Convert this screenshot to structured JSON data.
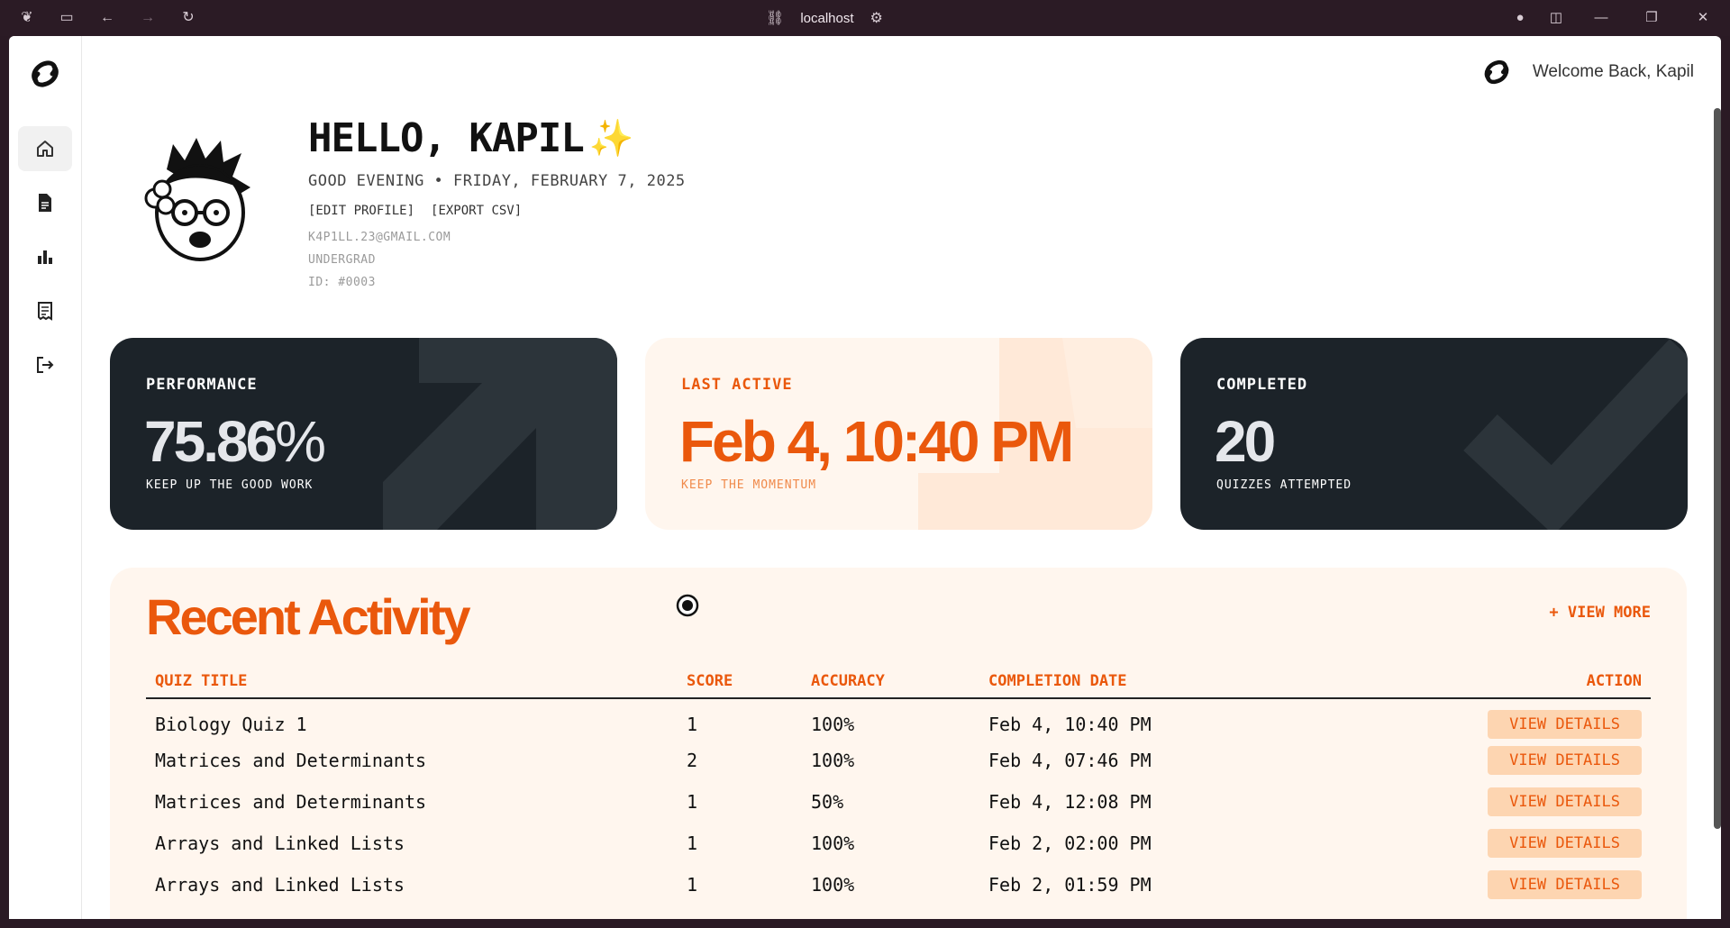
{
  "browser": {
    "url": "localhost"
  },
  "header": {
    "welcome": "Welcome Back, Kapil"
  },
  "profile": {
    "hello": "HELLO, KAPIL",
    "sparkle": "✨",
    "greeting": "GOOD EVENING • FRIDAY, FEBRUARY 7, 2025",
    "edit_profile": "[EDIT PROFILE]",
    "export_csv": "[EXPORT CSV]",
    "email": "K4P1LL.23@GMAIL.COM",
    "level": "UNDERGRAD",
    "id": "ID: #0003"
  },
  "sidebar": {
    "items": [
      {
        "name": "home",
        "active": true
      },
      {
        "name": "quizzes",
        "active": false
      },
      {
        "name": "analytics",
        "active": false
      },
      {
        "name": "reports",
        "active": false
      },
      {
        "name": "logout",
        "active": false
      }
    ]
  },
  "cards": {
    "performance": {
      "label": "PERFORMANCE",
      "value": "75.86",
      "unit": "%",
      "sub": "KEEP UP THE GOOD WORK"
    },
    "last_active": {
      "label": "LAST ACTIVE",
      "value": "Feb 4, 10:40 PM",
      "sub": "KEEP THE MOMENTUM"
    },
    "completed": {
      "label": "COMPLETED",
      "value": "20",
      "sub": "QUIZZES ATTEMPTED"
    }
  },
  "activity": {
    "title": "Recent Activity",
    "view_more": "+ VIEW MORE",
    "columns": [
      "QUIZ TITLE",
      "SCORE",
      "ACCURACY",
      "COMPLETION DATE",
      "ACTION"
    ],
    "rows": [
      {
        "title": "Biology Quiz 1",
        "score": "1",
        "accuracy": "100%",
        "date": "Feb 4, 10:40 PM",
        "action": "VIEW DETAILS"
      },
      {
        "title": "Matrices and Determinants",
        "score": "2",
        "accuracy": "100%",
        "date": "Feb 4, 07:46 PM",
        "action": "VIEW DETAILS"
      },
      {
        "title": "Matrices and Determinants",
        "score": "1",
        "accuracy": "50%",
        "date": "Feb 4, 12:08 PM",
        "action": "VIEW DETAILS"
      },
      {
        "title": "Arrays and Linked Lists",
        "score": "1",
        "accuracy": "100%",
        "date": "Feb 2, 02:00 PM",
        "action": "VIEW DETAILS"
      },
      {
        "title": "Arrays and Linked Lists",
        "score": "1",
        "accuracy": "100%",
        "date": "Feb 2, 01:59 PM",
        "action": "VIEW DETAILS"
      }
    ]
  },
  "colors": {
    "accent": "#ea580c",
    "dark_card": "#1c2329",
    "light_card": "#fff6ee",
    "button_bg": "#fdd5b1"
  }
}
